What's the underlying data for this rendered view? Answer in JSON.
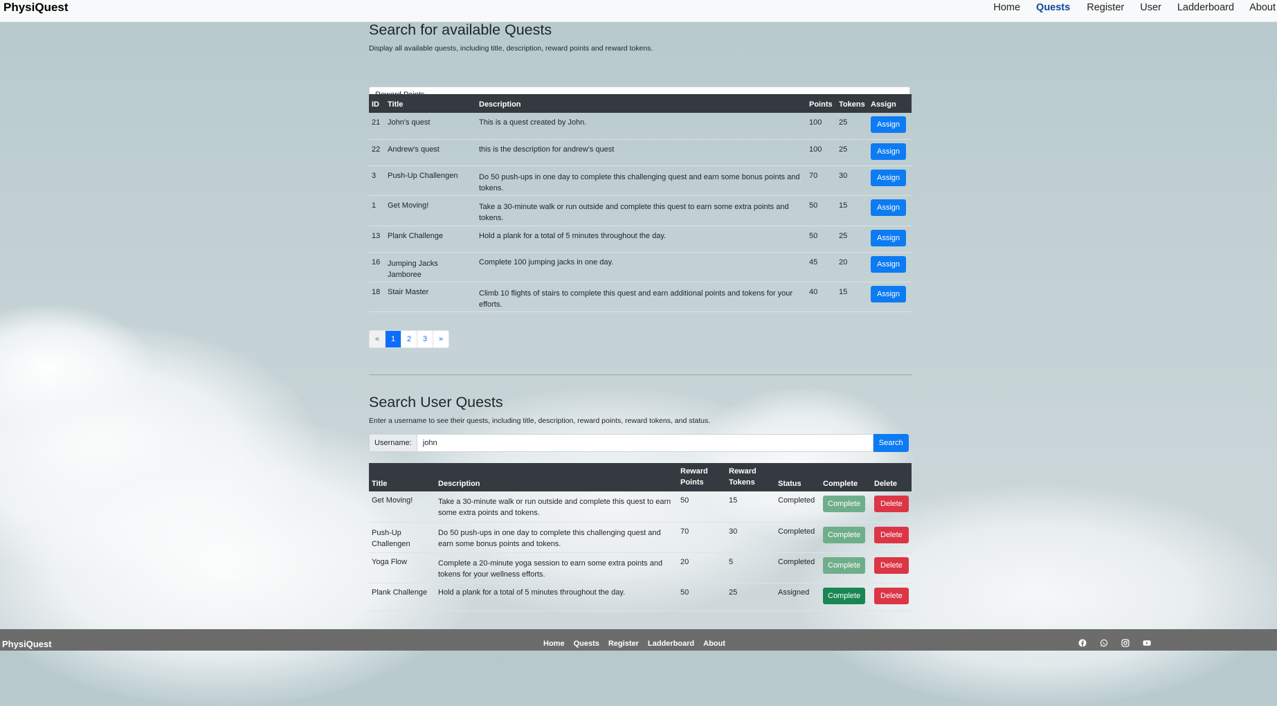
{
  "nav": {
    "brand": "PhysiQuest",
    "links": [
      {
        "label": "Home",
        "active": false
      },
      {
        "label": "Quests",
        "active": true
      },
      {
        "label": "Register",
        "active": false
      },
      {
        "label": "User",
        "active": false
      },
      {
        "label": "Ladderboard",
        "active": false
      },
      {
        "label": "About",
        "active": false
      }
    ]
  },
  "available": {
    "title": "Search for available Quests",
    "description": "Display all available quests, including title, description, reward points and reward tokens.",
    "sort_select": "Reward Points",
    "headers": [
      "ID",
      "Title",
      "Description",
      "Points",
      "Tokens",
      "Assign"
    ],
    "rows": [
      {
        "id": "21",
        "title": "John's quest",
        "description": "This is a quest created by John.",
        "points": "100",
        "tokens": "25",
        "action": "Assign"
      },
      {
        "id": "22",
        "title": "Andrew's quest",
        "description": "this is the description for andrew's quest",
        "points": "100",
        "tokens": "25",
        "action": "Assign"
      },
      {
        "id": "3",
        "title": "Push-Up Challengen",
        "description": "Do 50 push-ups in one day to complete this challenging quest and earn some bonus points and tokens.",
        "points": "70",
        "tokens": "30",
        "action": "Assign"
      },
      {
        "id": "1",
        "title": "Get Moving!",
        "description": "Take a 30-minute walk or run outside and complete this quest to earn some extra points and tokens.",
        "points": "50",
        "tokens": "15",
        "action": "Assign"
      },
      {
        "id": "13",
        "title": "Plank Challenge",
        "description": "Hold a plank for a total of 5 minutes throughout the day.",
        "points": "50",
        "tokens": "25",
        "action": "Assign"
      },
      {
        "id": "16",
        "title": "Jumping Jacks Jamboree",
        "description": "Complete 100 jumping jacks in one day.",
        "points": "45",
        "tokens": "20",
        "action": "Assign"
      },
      {
        "id": "18",
        "title": "Stair Master",
        "description": "Climb 10 flights of stairs to complete this quest and earn additional points and tokens for your efforts.",
        "points": "40",
        "tokens": "15",
        "action": "Assign"
      }
    ],
    "pagination": {
      "prev": "«",
      "pages": [
        "1",
        "2",
        "3"
      ],
      "next": "»",
      "current": "1"
    }
  },
  "user_quests": {
    "title": "Search User Quests",
    "description": "Enter a username to see their quests, including title, description, reward points, reward tokens, and status.",
    "username_label": "Username:",
    "username_value": "john",
    "search_label": "Search",
    "headers": [
      "Title",
      "Description",
      "Reward Points",
      "Reward Tokens",
      "Status",
      "Complete",
      "Delete"
    ],
    "rows": [
      {
        "title": "Get Moving!",
        "description": "Take a 30-minute walk or run outside and complete this quest to earn some extra points and tokens.",
        "points": "50",
        "tokens": "15",
        "status": "Completed",
        "complete_label": "Complete",
        "delete_label": "Delete",
        "complete_enabled": false
      },
      {
        "title": "Push-Up Challengen",
        "description": "Do 50 push-ups in one day to complete this challenging quest and earn some bonus points and tokens.",
        "points": "70",
        "tokens": "30",
        "status": "Completed",
        "complete_label": "Complete",
        "delete_label": "Delete",
        "complete_enabled": false
      },
      {
        "title": "Yoga Flow",
        "description": "Complete a 20-minute yoga session to earn some extra points and tokens for your wellness efforts.",
        "points": "20",
        "tokens": "5",
        "status": "Completed",
        "complete_label": "Complete",
        "delete_label": "Delete",
        "complete_enabled": false
      },
      {
        "title": "Plank Challenge",
        "description": "Hold a plank for a total of 5 minutes throughout the day.",
        "points": "50",
        "tokens": "25",
        "status": "Assigned",
        "complete_label": "Complete",
        "delete_label": "Delete",
        "complete_enabled": true
      }
    ]
  },
  "footer": {
    "brand": "PhysiQuest",
    "links": [
      "Home",
      "Quests",
      "Register",
      "Ladderboard",
      "About"
    ],
    "icons": [
      "facebook-icon",
      "whatsapp-icon",
      "instagram-icon",
      "youtube-icon"
    ]
  },
  "colors": {
    "primary": "#0d7bf2",
    "success": "#198754",
    "danger": "#dc3545",
    "table_head": "#343a40",
    "footer": "#6c6c6c"
  }
}
